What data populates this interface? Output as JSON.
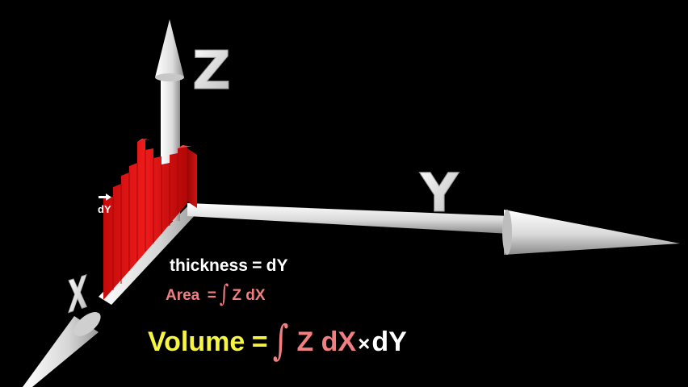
{
  "axes": {
    "z_label": "Z",
    "y_label": "Y",
    "x_label": "X",
    "dy_label": "dY"
  },
  "equations": {
    "thickness": {
      "lhs": "thickness",
      "equals": "=",
      "rhs": "dY"
    },
    "area": {
      "lhs": "Area",
      "equals": "=",
      "integral": "∫",
      "rhs": "Z dX"
    },
    "volume": {
      "lhs": "Volume",
      "equals": "=",
      "integral": "∫",
      "integrand": "Z dX",
      "times": "×",
      "factor": "dY"
    }
  },
  "colors": {
    "background": "#000000",
    "axis": "#e6e6e6",
    "slab": "#e01010",
    "thickness_text": "#ffffff",
    "area_text": "#f27f7f",
    "volume_lhs": "#f5f542",
    "volume_integral": "#f27f7f",
    "volume_factor": "#ffffff"
  }
}
